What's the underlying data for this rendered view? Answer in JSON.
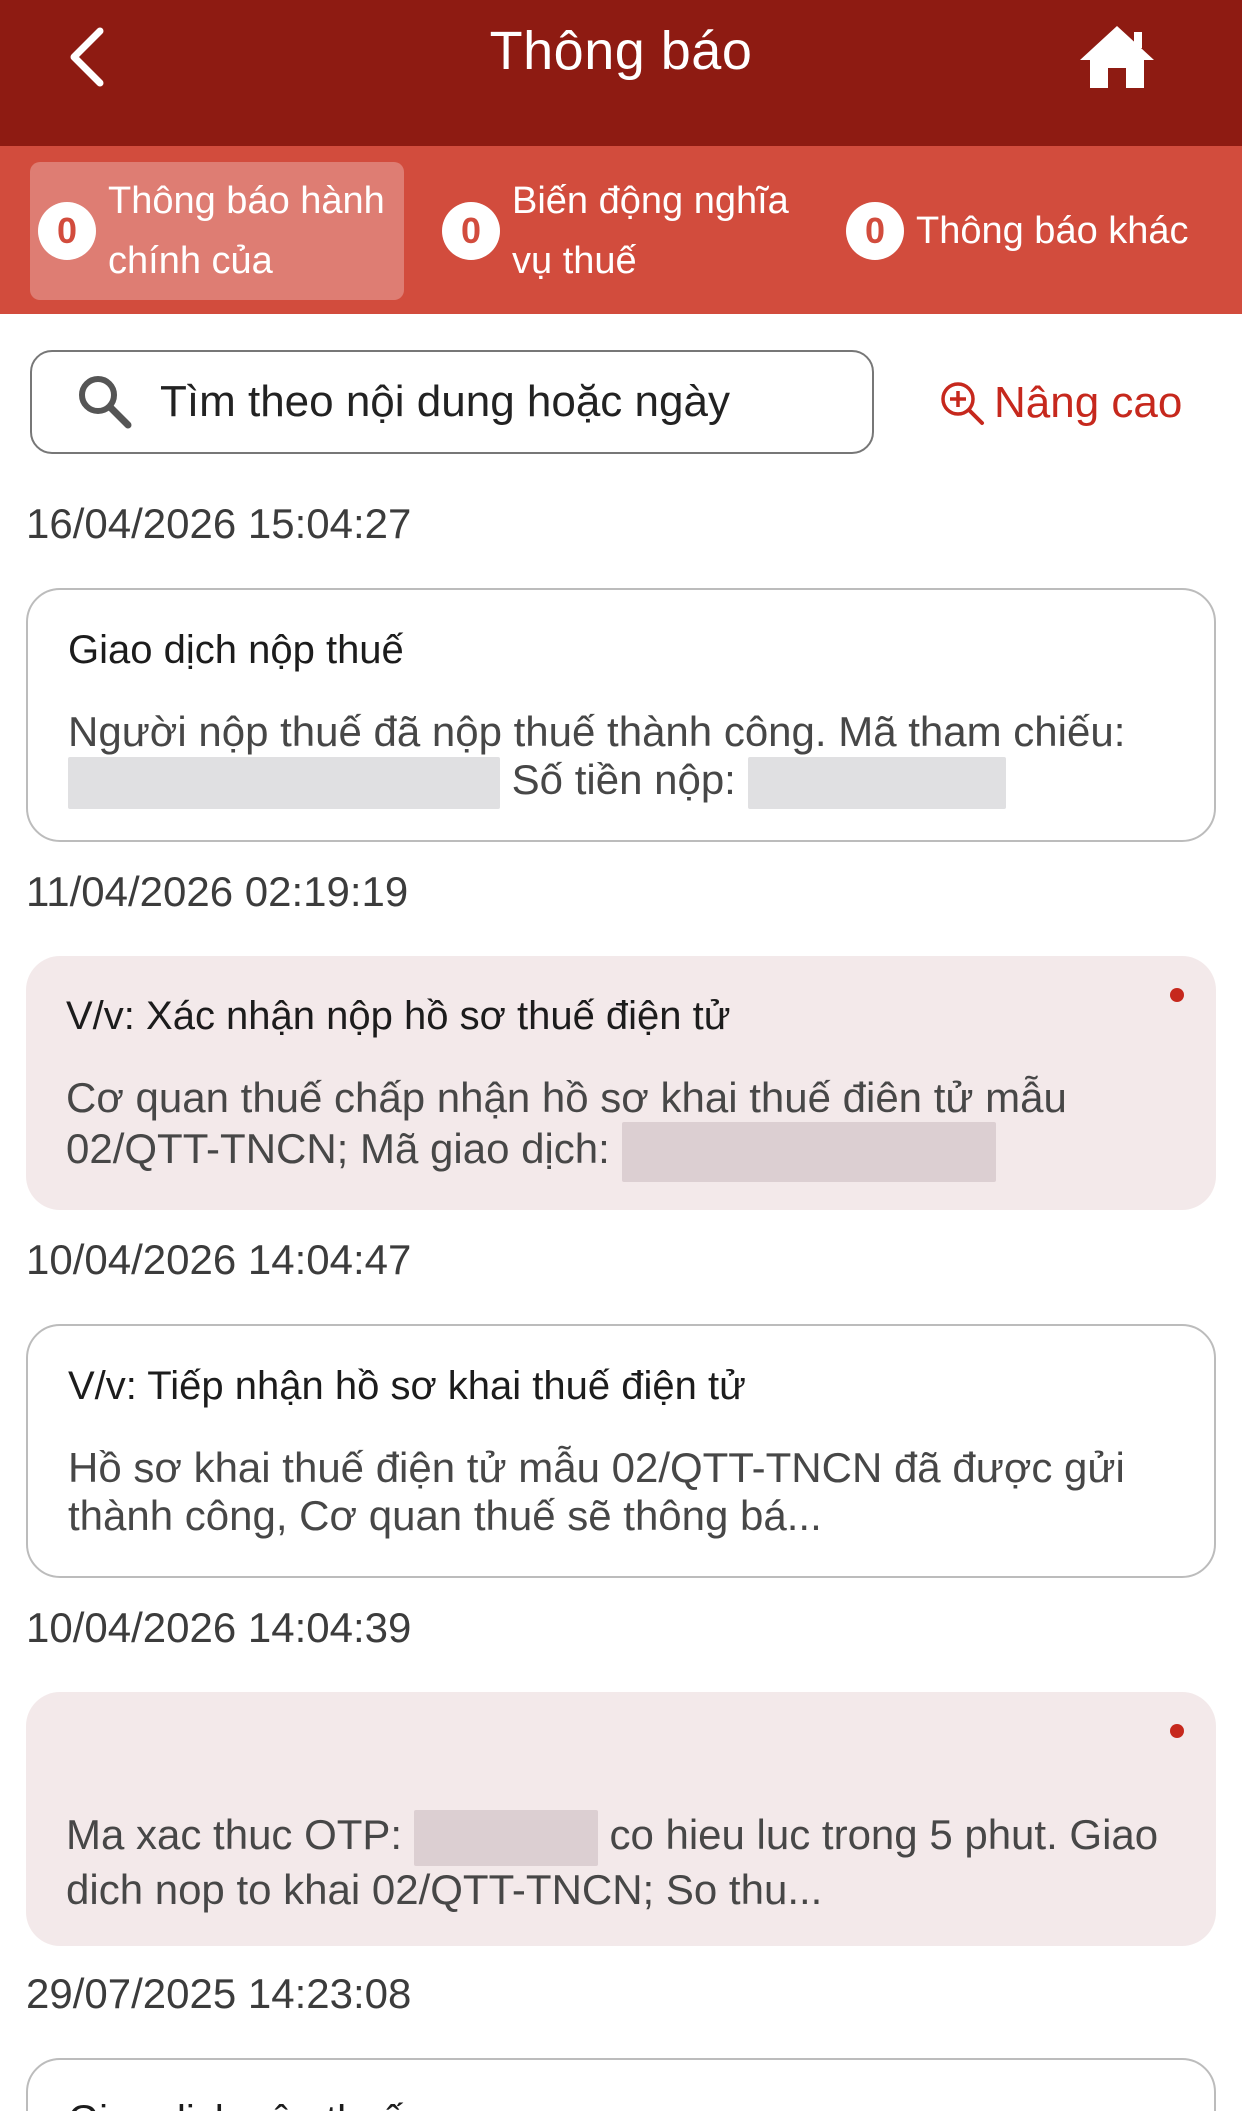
{
  "header": {
    "title": "Thông báo",
    "back_icon": "chevron-left-icon",
    "home_icon": "home-icon"
  },
  "tabs": [
    {
      "count": "0",
      "label": "Thông báo hành chính của",
      "active": true
    },
    {
      "count": "0",
      "label": "Biến động nghĩa vụ thuế",
      "active": false
    },
    {
      "count": "0",
      "label": "Thông báo khác",
      "active": false
    }
  ],
  "search": {
    "placeholder": "Tìm theo nội dung hoặc ngày",
    "advanced_label": "Nâng cao"
  },
  "notifications": [
    {
      "date": "16/04/2026 15:04:27",
      "title": "Giao dịch nộp thuế",
      "body_part1": "Người nộp thuế đã nộp thuế thành công. Mã tham chiếu:",
      "body_part2": "Số tiền nộp:",
      "unread": false
    },
    {
      "date": "11/04/2026 02:19:19",
      "title": "V/v: Xác nhận nộp hồ sơ thuế điện tử",
      "body_part1": "Cơ quan thuế chấp nhận hồ sơ khai thuế điên tử mẫu 02/QTT-TNCN; Mã giao dịch:",
      "unread": true
    },
    {
      "date": "10/04/2026 14:04:47",
      "title": "V/v: Tiếp nhận hồ sơ khai thuế điện tử",
      "body_part1": "Hồ sơ khai thuế điện tử mẫu 02/QTT-TNCN đã được gửi thành công, Cơ quan thuế sẽ thông bá...",
      "unread": false
    },
    {
      "date": "10/04/2026 14:04:39",
      "title": "",
      "body_part1": "Ma xac thuc OTP:",
      "body_part2": "co hieu luc trong 5 phut. Giao dich nop to khai 02/QTT-TNCN; So thu...",
      "unread": true
    },
    {
      "date": "29/07/2025 14:23:08",
      "title": "Giao dịch nộp thuế",
      "unread": false
    }
  ],
  "colors": {
    "header_bg": "#8e1b12",
    "tabs_bg": "#d24c3d",
    "accent": "#c6281d",
    "unread_card_bg": "#f3e9ea"
  }
}
